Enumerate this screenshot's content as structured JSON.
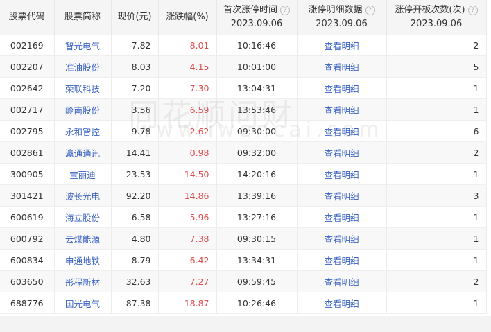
{
  "headers": {
    "code": "股票代码",
    "name": "股票简称",
    "price": "现价(元)",
    "change": "涨跌幅(%)",
    "first_time": "首次涨停时间",
    "detail": "涨停明细数据",
    "open_count": "涨停开板次数(次)",
    "date": "2023.09.06",
    "help": "?"
  },
  "rows": [
    {
      "code": "002169",
      "name": "智光电气",
      "price": "7.82",
      "change": "8.01",
      "time": "10:16:46",
      "detail": "查看明细",
      "count": "2"
    },
    {
      "code": "002207",
      "name": "准油股份",
      "price": "8.03",
      "change": "4.15",
      "time": "10:01:00",
      "detail": "查看明细",
      "count": "5"
    },
    {
      "code": "002642",
      "name": "荣联科技",
      "price": "7.20",
      "change": "7.30",
      "time": "13:04:31",
      "detail": "查看明细",
      "count": "1"
    },
    {
      "code": "002717",
      "name": "岭南股份",
      "price": "3.56",
      "change": "6.59",
      "time": "13:53:46",
      "detail": "查看明细",
      "count": "1"
    },
    {
      "code": "002795",
      "name": "永和智控",
      "price": "9.78",
      "change": "2.62",
      "time": "09:30:00",
      "detail": "查看明细",
      "count": "6"
    },
    {
      "code": "002861",
      "name": "瀛通通讯",
      "price": "14.41",
      "change": "0.98",
      "time": "09:32:00",
      "detail": "查看明细",
      "count": "2"
    },
    {
      "code": "300905",
      "name": "宝丽迪",
      "price": "23.53",
      "change": "14.50",
      "time": "14:20:16",
      "detail": "查看明细",
      "count": "1"
    },
    {
      "code": "301421",
      "name": "波长光电",
      "price": "92.20",
      "change": "14.86",
      "time": "13:39:16",
      "detail": "查看明细",
      "count": "3"
    },
    {
      "code": "600619",
      "name": "海立股份",
      "price": "6.58",
      "change": "5.96",
      "time": "13:27:16",
      "detail": "查看明细",
      "count": "1"
    },
    {
      "code": "600792",
      "name": "云煤能源",
      "price": "4.80",
      "change": "7.38",
      "time": "09:30:15",
      "detail": "查看明细",
      "count": "1"
    },
    {
      "code": "600834",
      "name": "申通地铁",
      "price": "8.79",
      "change": "6.42",
      "time": "13:34:31",
      "detail": "查看明细",
      "count": "1"
    },
    {
      "code": "603650",
      "name": "彤程新材",
      "price": "32.63",
      "change": "7.27",
      "time": "09:59:45",
      "detail": "查看明细",
      "count": "2"
    },
    {
      "code": "688776",
      "name": "国光电气",
      "price": "87.38",
      "change": "18.87",
      "time": "10:26:46",
      "detail": "查看明细",
      "count": "1"
    }
  ],
  "watermark": {
    "cn": "同花顺问财",
    "url": "www.iwencai.com"
  }
}
